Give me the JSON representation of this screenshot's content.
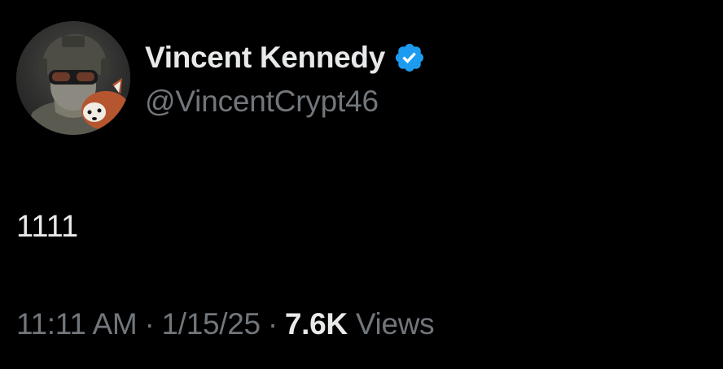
{
  "author": {
    "display_name": "Vincent Kennedy",
    "handle": "@VincentCrypt46",
    "verified": true,
    "avatar_icon": "avatar-image",
    "verified_icon": "verified-badge-icon"
  },
  "tweet": {
    "text": "1111"
  },
  "meta": {
    "time": "11:11 AM",
    "separator": "·",
    "date": "1/15/25",
    "views_count": "7.6K",
    "views_label": "Views"
  },
  "colors": {
    "background": "#000000",
    "primary_text": "#e7e9ea",
    "secondary_text": "#71767b",
    "verified_blue": "#1d9bf0"
  }
}
